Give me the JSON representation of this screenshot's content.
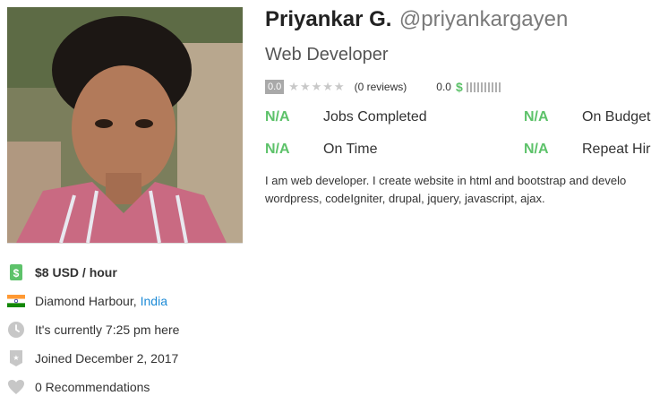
{
  "profile": {
    "name": "Priyankar G.",
    "username": "@priyankargayen",
    "tagline": "Web Developer"
  },
  "rating": {
    "score": "0.0",
    "stars_filled": 0,
    "stars_total": 5,
    "reviews": "(0 reviews)",
    "earnings_score": "0.0",
    "earnings_symbol": "$"
  },
  "stats": [
    {
      "value": "N/A",
      "label": "Jobs Completed"
    },
    {
      "value": "N/A",
      "label": "On Budget"
    },
    {
      "value": "N/A",
      "label": "On Time"
    },
    {
      "value": "N/A",
      "label": "Repeat Hire"
    }
  ],
  "bio": {
    "line1": "I am web developer. I create website in html and bootstrap and develo",
    "line2": "wordpress, codeIgniter, drupal, jquery, javascript, ajax."
  },
  "info": {
    "rate": "$8 USD / hour",
    "city": "Diamond Harbour,",
    "country": "India",
    "local_time": "It's currently 7:25 pm here",
    "joined": "Joined December 2, 2017",
    "recommendations": "0 Recommendations"
  },
  "colors": {
    "accent_green": "#5dc26a",
    "link_blue": "#1c8ad6",
    "muted_gray": "#a9a9a9"
  }
}
